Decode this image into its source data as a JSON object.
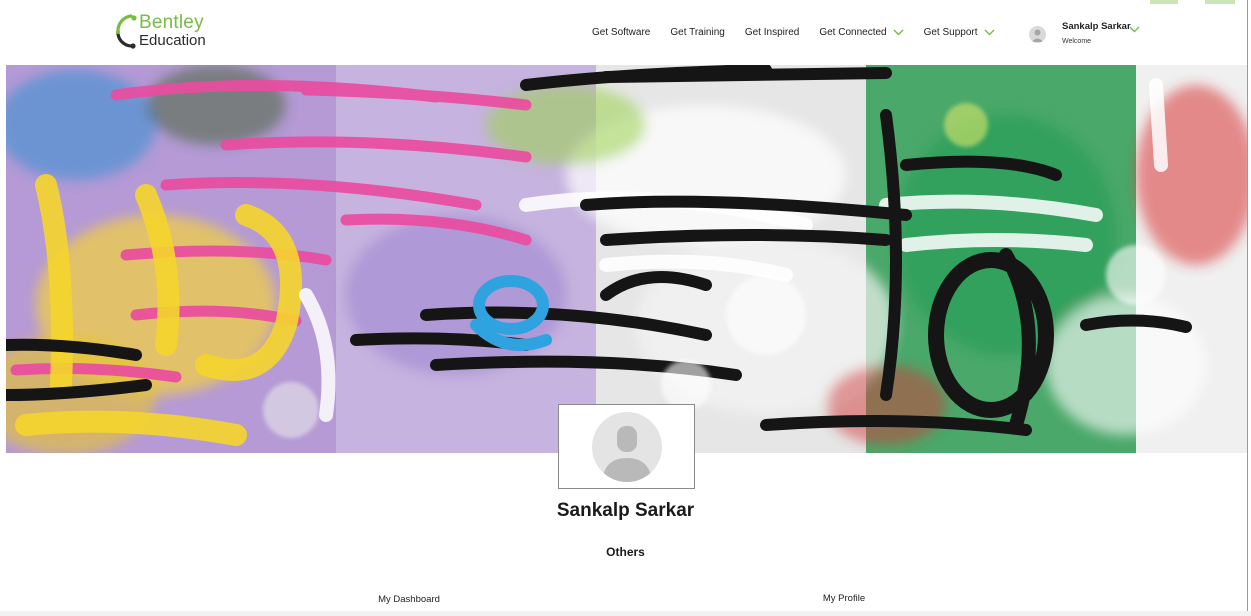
{
  "brand": {
    "name_line1": "Bentley",
    "name_line2": "Education",
    "accent_color": "#77bc43"
  },
  "nav": {
    "items": [
      {
        "label": "Get Software",
        "has_dropdown": false
      },
      {
        "label": "Get Training",
        "has_dropdown": false
      },
      {
        "label": "Get Inspired",
        "has_dropdown": false
      },
      {
        "label": "Get Connected",
        "has_dropdown": true
      },
      {
        "label": "Get Support",
        "has_dropdown": true
      }
    ]
  },
  "user": {
    "name": "Sankalp Sarkar",
    "greeting": "Welcome"
  },
  "profile": {
    "name": "Sankalp Sarkar",
    "role": "Others"
  },
  "tabs": [
    {
      "label": "My Dashboard",
      "active": false
    },
    {
      "label": "My Profile",
      "active": true
    }
  ],
  "icons": {
    "chevron": "chevron-down-icon",
    "avatar": "avatar-icon"
  }
}
